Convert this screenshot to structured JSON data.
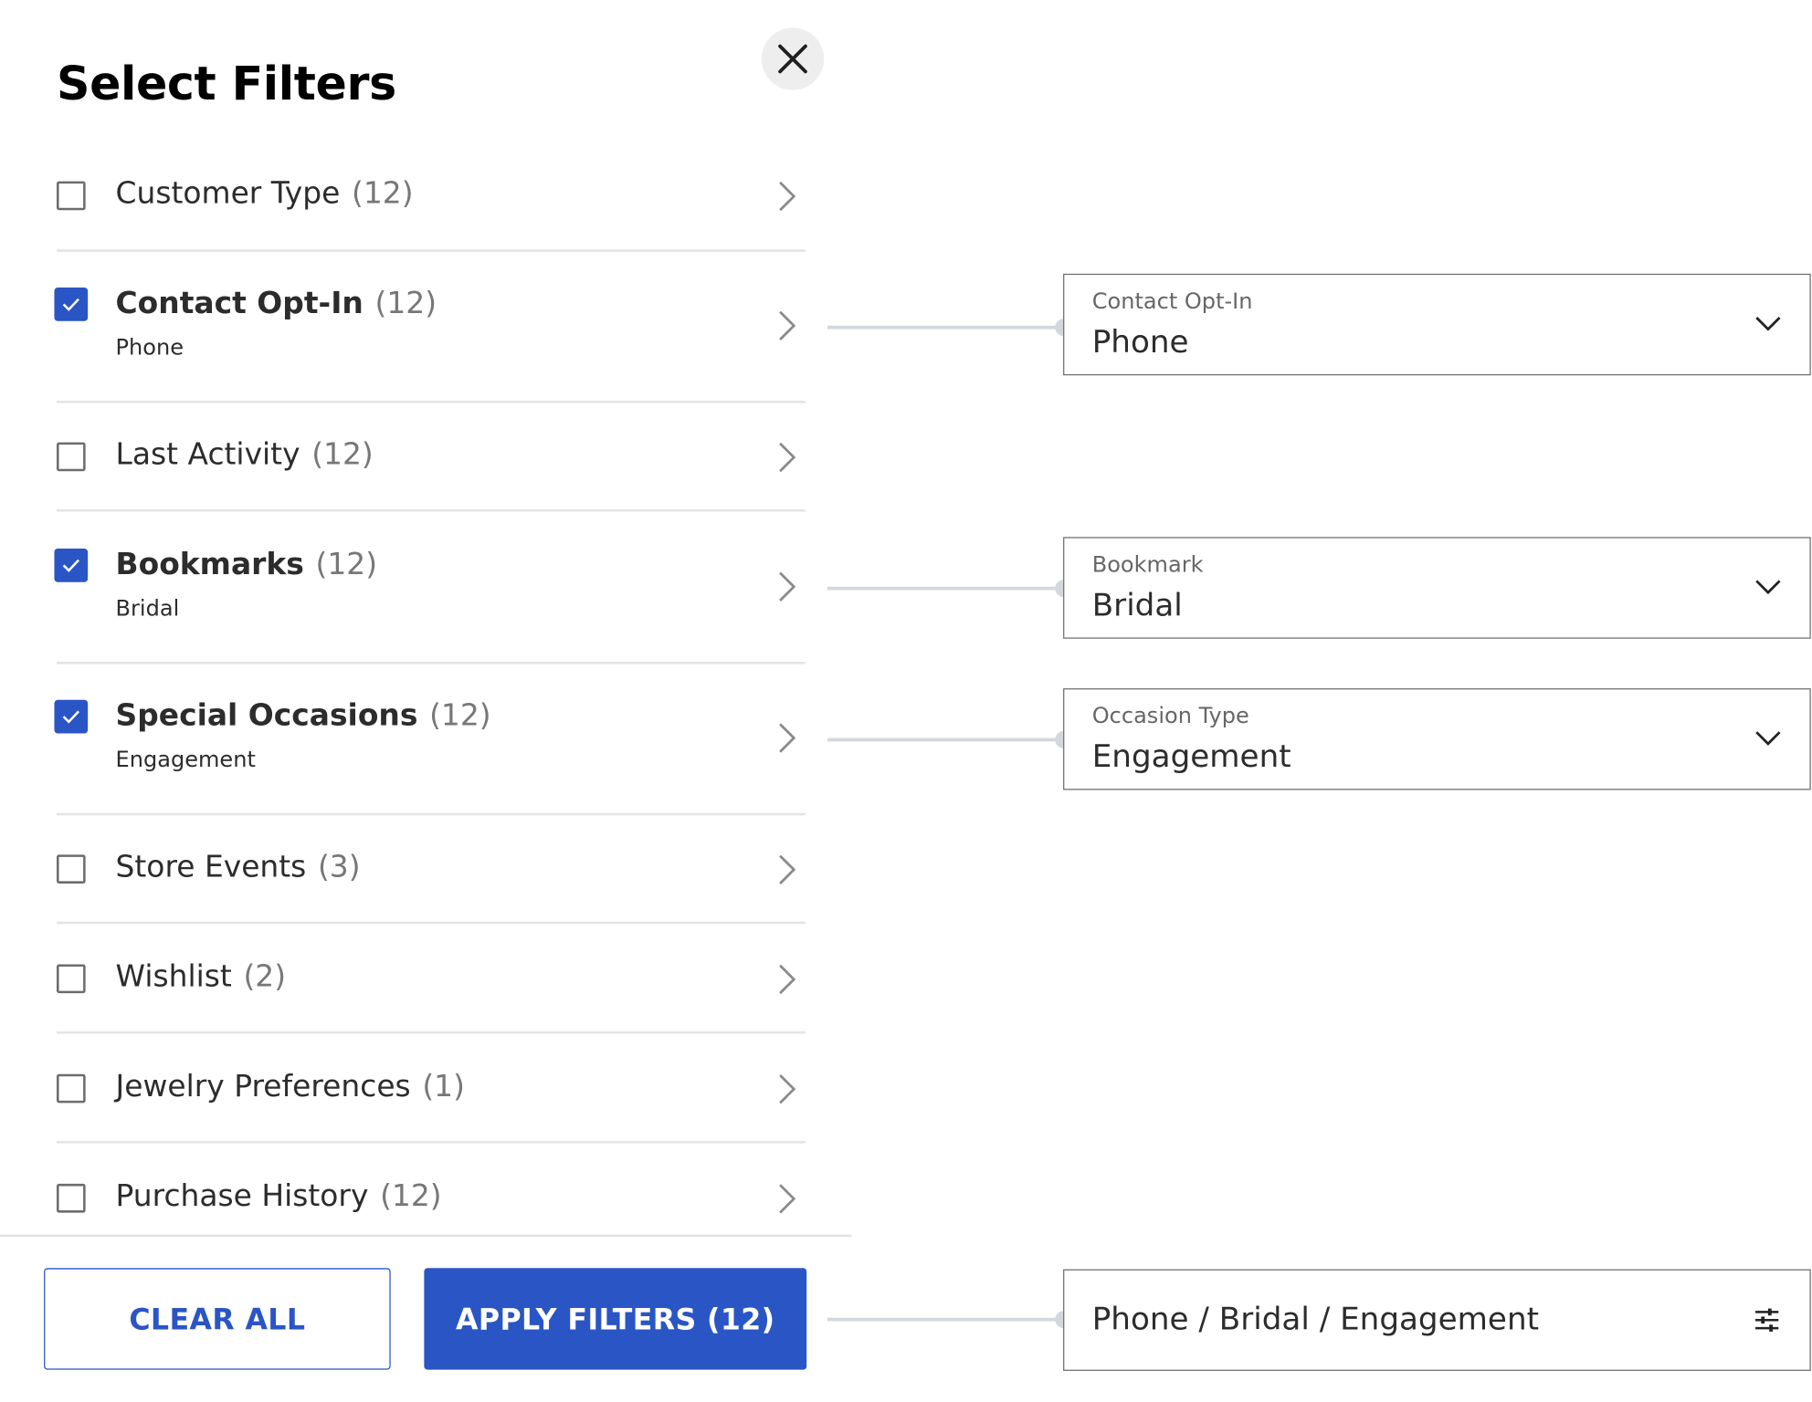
{
  "panel": {
    "title": "Select Filters"
  },
  "filters": [
    {
      "name": "Customer Type",
      "count": "(12)",
      "checked": false,
      "sub": ""
    },
    {
      "name": "Contact Opt-In",
      "count": "(12)",
      "checked": true,
      "sub": "Phone"
    },
    {
      "name": "Last Activity",
      "count": "(12)",
      "checked": false,
      "sub": ""
    },
    {
      "name": "Bookmarks",
      "count": "(12)",
      "checked": true,
      "sub": "Bridal"
    },
    {
      "name": "Special Occasions",
      "count": "(12)",
      "checked": true,
      "sub": "Engagement"
    },
    {
      "name": "Store Events",
      "count": "(3)",
      "checked": false,
      "sub": ""
    },
    {
      "name": "Wishlist",
      "count": "(2)",
      "checked": false,
      "sub": ""
    },
    {
      "name": "Jewelry Preferences",
      "count": "(1)",
      "checked": false,
      "sub": ""
    },
    {
      "name": "Purchase History",
      "count": "(12)",
      "checked": false,
      "sub": ""
    }
  ],
  "dropdowns": [
    {
      "label": "Contact Opt-In",
      "value": "Phone"
    },
    {
      "label": "Bookmark",
      "value": "Bridal"
    },
    {
      "label": "Occasion Type",
      "value": "Engagement"
    }
  ],
  "footer": {
    "clear_label": "CLEAR ALL",
    "apply_label": "APPLY FILTERS (12)"
  },
  "summary": {
    "text": "Phone / Bridal / Engagement"
  },
  "colors": {
    "accent": "#2a55c5",
    "divider": "#e4e4e4",
    "connector": "#d4d8de"
  }
}
